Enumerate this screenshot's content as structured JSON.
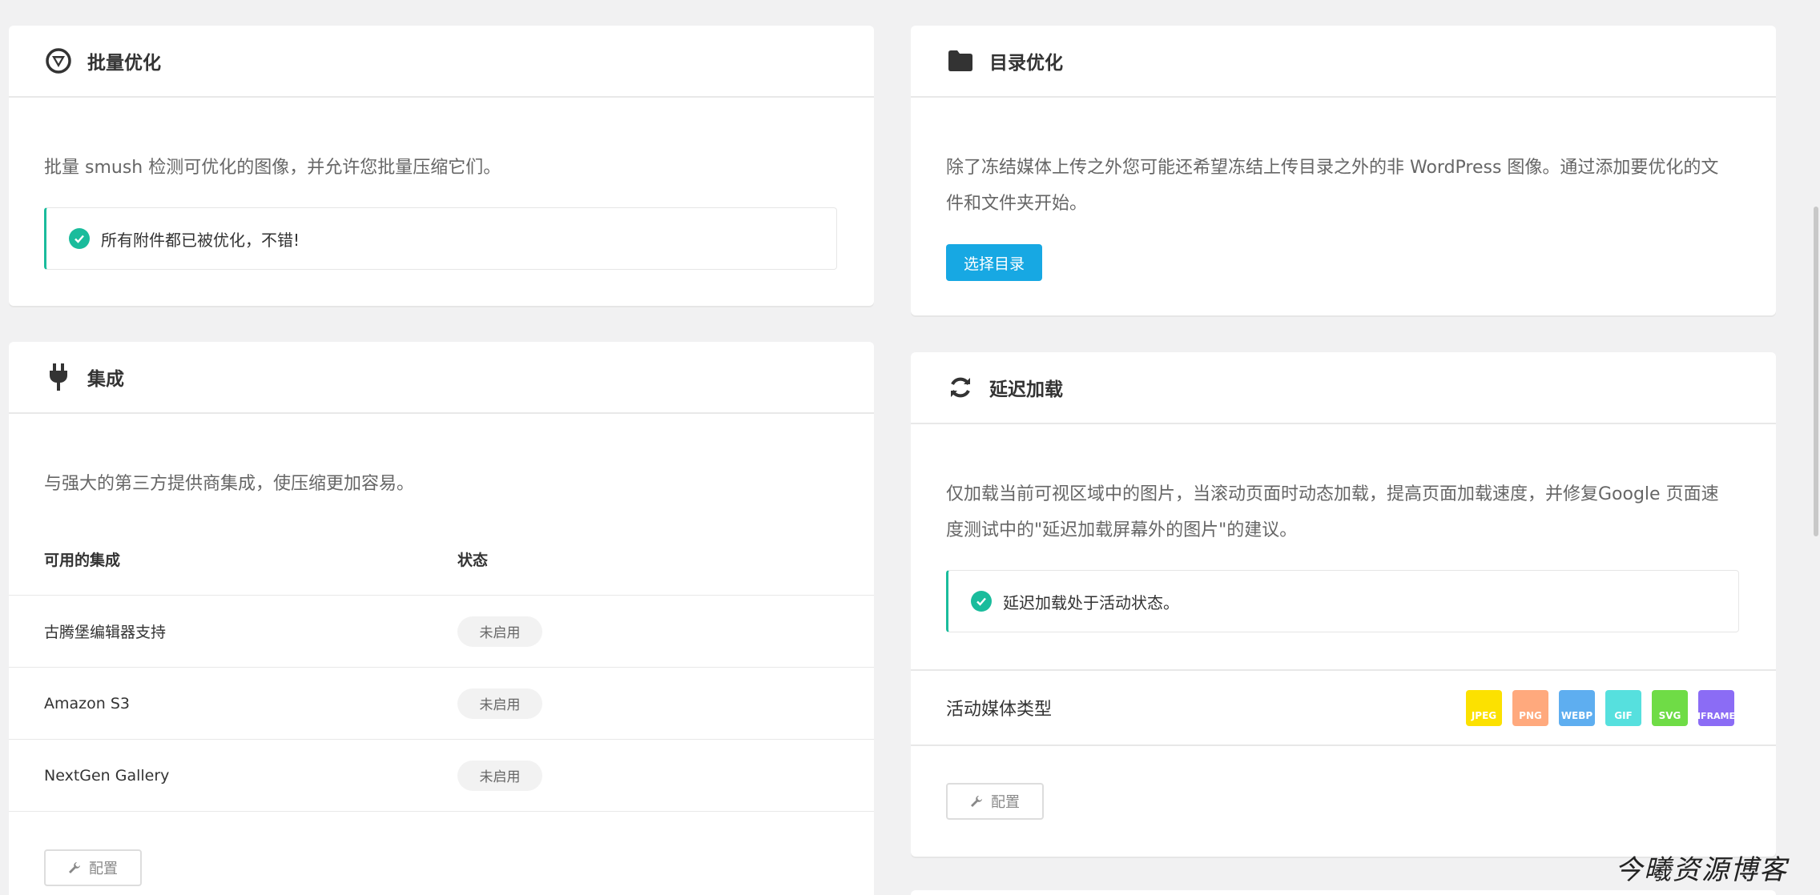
{
  "bulk": {
    "title": "批量优化",
    "description": "批量 smush 检测可优化的图像，并允许您批量压缩它们。",
    "notice": "所有附件都已被优化，不错!"
  },
  "directory": {
    "title": "目录优化",
    "description_line1": "除了冻结媒体上传之外您可能还希望冻结上传目录之外的非 WordPress 图像。通过添加要优化的文",
    "description_line2": "件和文件夹开始。",
    "button": "选择目录"
  },
  "integrations": {
    "title": "集成",
    "description": "与强大的第三方提供商集成，使压缩更加容易。",
    "col_name": "可用的集成",
    "col_status": "状态",
    "rows": [
      {
        "name": "古腾堡编辑器支持",
        "status": "未启用"
      },
      {
        "name": "Amazon S3",
        "status": "未启用"
      },
      {
        "name": "NextGen Gallery",
        "status": "未启用"
      }
    ],
    "config_button": "配置"
  },
  "lazyload": {
    "title": "延迟加载",
    "description_line1": "仅加载当前可视区域中的图片，当滚动页面时动态加载，提高页面加载速度，并修复Google 页面速",
    "description_line2": "度测试中的\"延迟加载屏幕外的图片\"的建议。",
    "notice": "延迟加载处于活动状态。",
    "media_label": "活动媒体类型",
    "media_types": [
      {
        "label": "JPEG",
        "color": "#fce100"
      },
      {
        "label": "PNG",
        "color": "#ffa97d"
      },
      {
        "label": "WEBP",
        "color": "#5eaef0"
      },
      {
        "label": "GIF",
        "color": "#56e0de"
      },
      {
        "label": "SVG",
        "color": "#6fdc46"
      },
      {
        "label": "IFRAME",
        "color": "#8b6cf5"
      }
    ],
    "config_button": "配置"
  },
  "watermark": "今曦资源博客"
}
